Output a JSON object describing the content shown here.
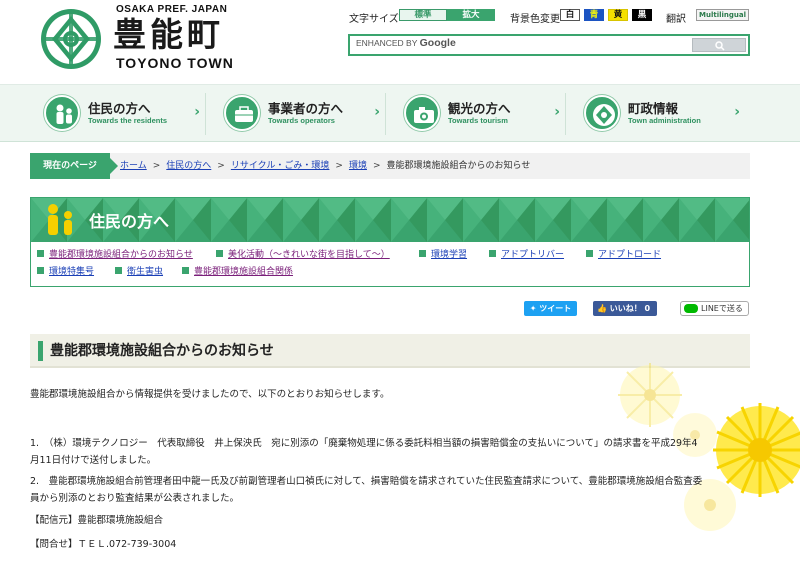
{
  "header": {
    "pref": "OSAKA PREF. JAPAN",
    "town_jp": "豊能町",
    "town_en": "TOYONO TOWN",
    "font_size_label": "文字サイズ",
    "font_standard": "標準",
    "font_large": "拡大",
    "bg_color_label": "背景色変更",
    "bg_white": "白",
    "bg_blue": "青",
    "bg_yellow": "黄",
    "bg_black": "黒",
    "translate_label": "翻訳",
    "multilingual": "Multilingual",
    "search_prefix": "ENHANCED BY",
    "search_brand": "Google"
  },
  "nav": [
    {
      "title": "住民の方へ",
      "sub": "Towards the residents"
    },
    {
      "title": "事業者の方へ",
      "sub": "Towards operators"
    },
    {
      "title": "観光の方へ",
      "sub": "Towards tourism"
    },
    {
      "title": "町政情報",
      "sub": "Town administration"
    }
  ],
  "breadcrumb": {
    "now_label": "現在のページ",
    "items": [
      "ホーム",
      "住民の方へ",
      "リサイクル・ごみ・環境",
      "環境"
    ],
    "current": "豊能郡環境施設組合からのお知らせ"
  },
  "section": {
    "title": "住民の方へ",
    "links": [
      "豊能郡環境施設組合からのお知らせ",
      "美化活動（～きれいな街を目指して～）",
      "環境学習",
      "アドプトリバー",
      "アドプトロード",
      "環境特集号",
      "衛生害虫",
      "豊能郡環境施設組合関係"
    ]
  },
  "sns": {
    "tweet": "ツイート",
    "like": "いいね！ 0",
    "line": "LINEで送る"
  },
  "article": {
    "title": "豊能郡環境施設組合からのお知らせ",
    "intro": "豊能郡環境施設組合から情報提供を受けましたので、以下のとおりお知らせします。",
    "item1_line1": "1.　（株）環境テクノロジー　代表取締役　井上保泱氏　宛に別添の「廃棄物処理に係る委託料相当額の損害賠償金の支払いについて」の請求書を平成29年4",
    "item1_line2": "月11日付けで送付しました。",
    "item2_line1": "2.　豊能郡環境施設組合前管理者田中龍一氏及び前副管理者山口禎氏に対して、損害賠償を請求されていた住民監査請求について、豊能郡環境施設組合監査委",
    "item2_line2": "員から別添のとおり監査結果が公表されました。",
    "sender": "【配信元】豊能郡環境施設組合",
    "contact": "【問合せ】ＴＥＬ.072-739-3004"
  },
  "colors": {
    "accent": "#3aa46e",
    "link": "#1a3fb6",
    "visited": "#7a1f7a"
  }
}
